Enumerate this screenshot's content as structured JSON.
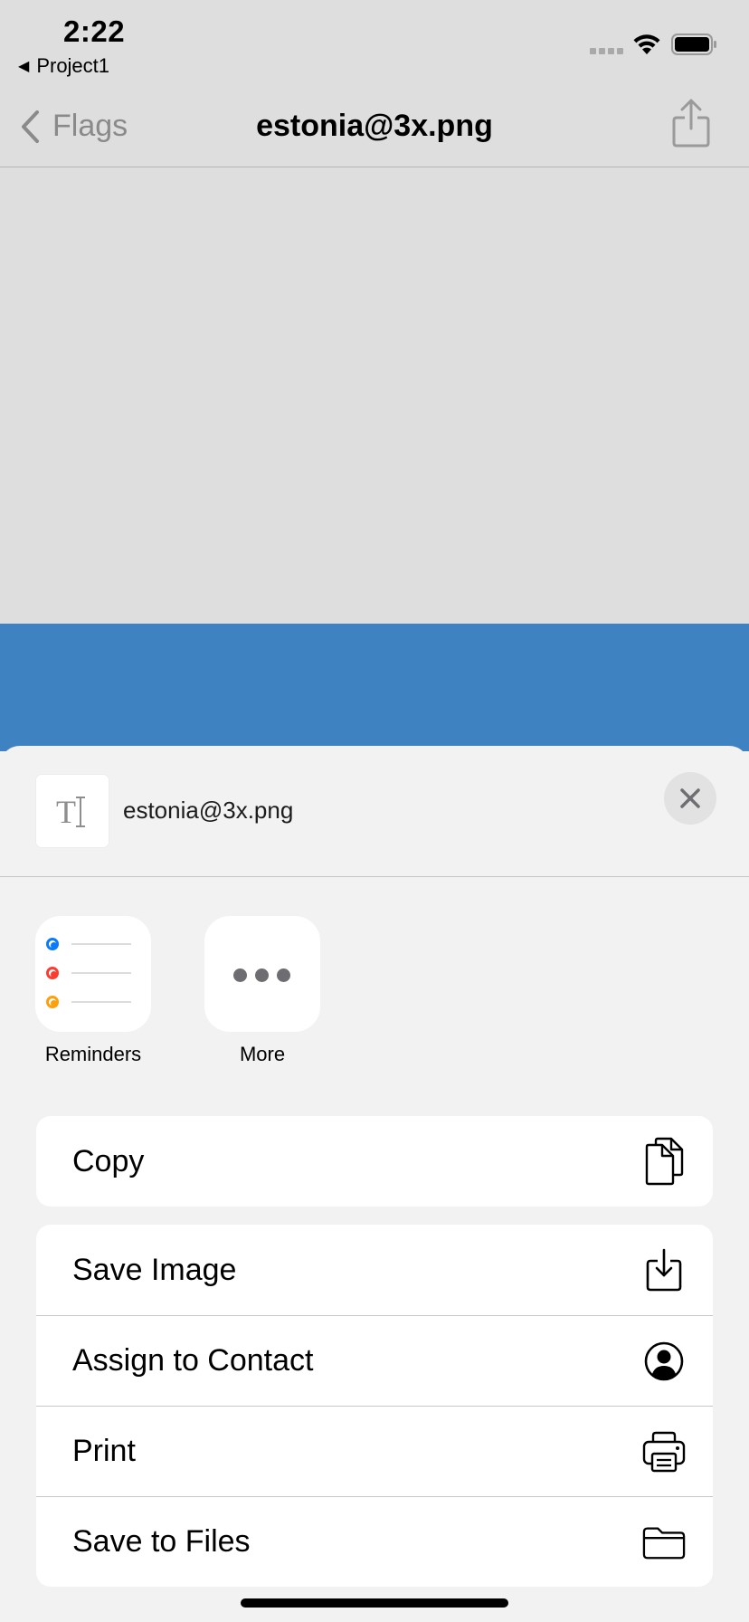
{
  "status_bar": {
    "time": "2:22",
    "back_app_label": "Project1"
  },
  "nav": {
    "back_label": "Flags",
    "title": "estonia@3x.png"
  },
  "colors": {
    "flag_blue": "#3f82c1",
    "reminder_blue": "#0a7aff",
    "reminder_red": "#ff3b30",
    "reminder_orange": "#ff9f0a"
  },
  "sheet": {
    "filename": "estonia@3x.png",
    "apps": [
      {
        "label": "Reminders",
        "icon": "reminders-app-icon"
      },
      {
        "label": "More",
        "icon": "more-icon"
      }
    ],
    "copy_group": [
      {
        "label": "Copy",
        "icon": "copy-icon"
      }
    ],
    "actions": [
      {
        "label": "Save Image",
        "icon": "save-image-icon"
      },
      {
        "label": "Assign to Contact",
        "icon": "contact-icon"
      },
      {
        "label": "Print",
        "icon": "printer-icon"
      },
      {
        "label": "Save to Files",
        "icon": "folder-icon"
      }
    ]
  }
}
